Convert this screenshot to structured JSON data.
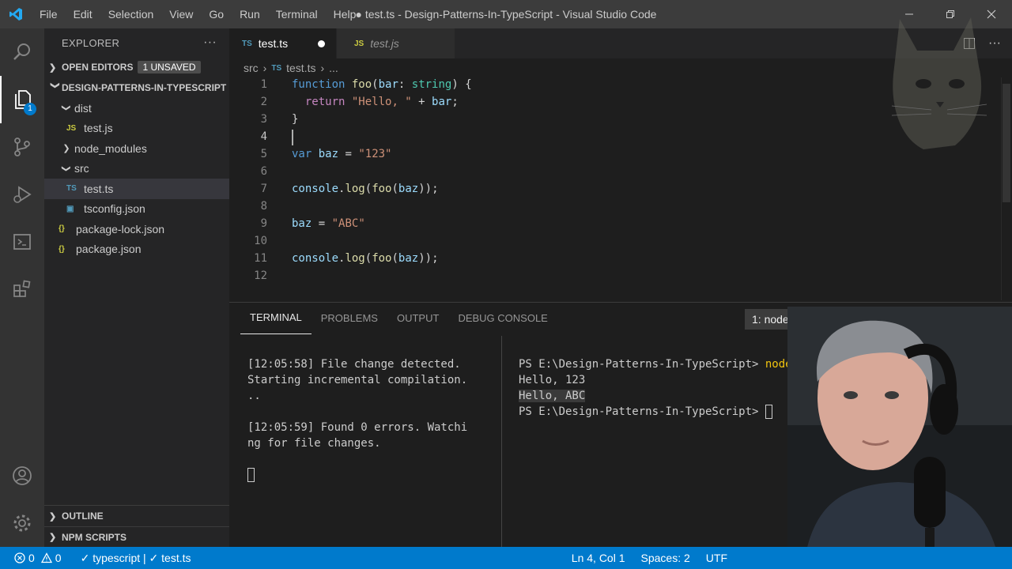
{
  "window": {
    "title": "● test.ts - Design-Patterns-In-TypeScript - Visual Studio Code",
    "menu": [
      "File",
      "Edit",
      "Selection",
      "View",
      "Go",
      "Run",
      "Terminal",
      "Help"
    ]
  },
  "activity_bar": {
    "explorer_badge": "1"
  },
  "sidebar": {
    "title": "EXPLORER",
    "more": "···",
    "open_editors": {
      "label": "OPEN EDITORS",
      "badge": "1 UNSAVED"
    },
    "project": "DESIGN-PATTERNS-IN-TYPESCRIPT",
    "tree": {
      "dist": "dist",
      "dist_test_js": "test.js",
      "node_modules": "node_modules",
      "src": "src",
      "src_test_ts": "test.ts",
      "tsconfig": "tsconfig.json",
      "package_lock": "package-lock.json",
      "package": "package.json"
    },
    "outline": "OUTLINE",
    "npm_scripts": "NPM SCRIPTS"
  },
  "tabs": {
    "active": {
      "icon": "TS",
      "label": "test.ts"
    },
    "other": {
      "icon": "JS",
      "label": "test.js"
    }
  },
  "breadcrumb": {
    "folder": "src",
    "sep1": "›",
    "icon": "TS",
    "file": "test.ts",
    "sep2": "›",
    "more": "..."
  },
  "editor": {
    "line_numbers": [
      "1",
      "2",
      "3",
      "4",
      "5",
      "6",
      "7",
      "8",
      "9",
      "10",
      "11",
      "12"
    ],
    "cursor": "Ln 4, Col 1"
  },
  "panel": {
    "tabs": [
      "TERMINAL",
      "PROBLEMS",
      "OUTPUT",
      "DEBUG CONSOLE"
    ],
    "terminal_select": "1: node, powershell",
    "left_terminal": [
      "[12:05:58] File change detected.",
      "Starting incremental compilation.",
      "..",
      "",
      "[12:05:59] Found 0 errors. Watchi",
      "ng for file changes."
    ],
    "right_terminal": {
      "prompt1": "PS E:\\Design-Patterns-In-TypeScript> ",
      "cmd1": "node",
      "out1": "Hello, 123",
      "out2": "Hello, ABC",
      "prompt2": "PS E:\\Design-Patterns-In-TypeScript> "
    }
  },
  "status_bar": {
    "errors": "0",
    "warnings": "0",
    "ts_check": "✓ typescript | ✓ test.ts",
    "position": "Ln 4, Col 1",
    "spaces": "Spaces: 2",
    "encoding": "UTF"
  },
  "colors": {
    "status_bar": "#007acc",
    "sidebar": "#252526",
    "editor": "#1e1e1e",
    "title_bar": "#3c3c3c"
  }
}
